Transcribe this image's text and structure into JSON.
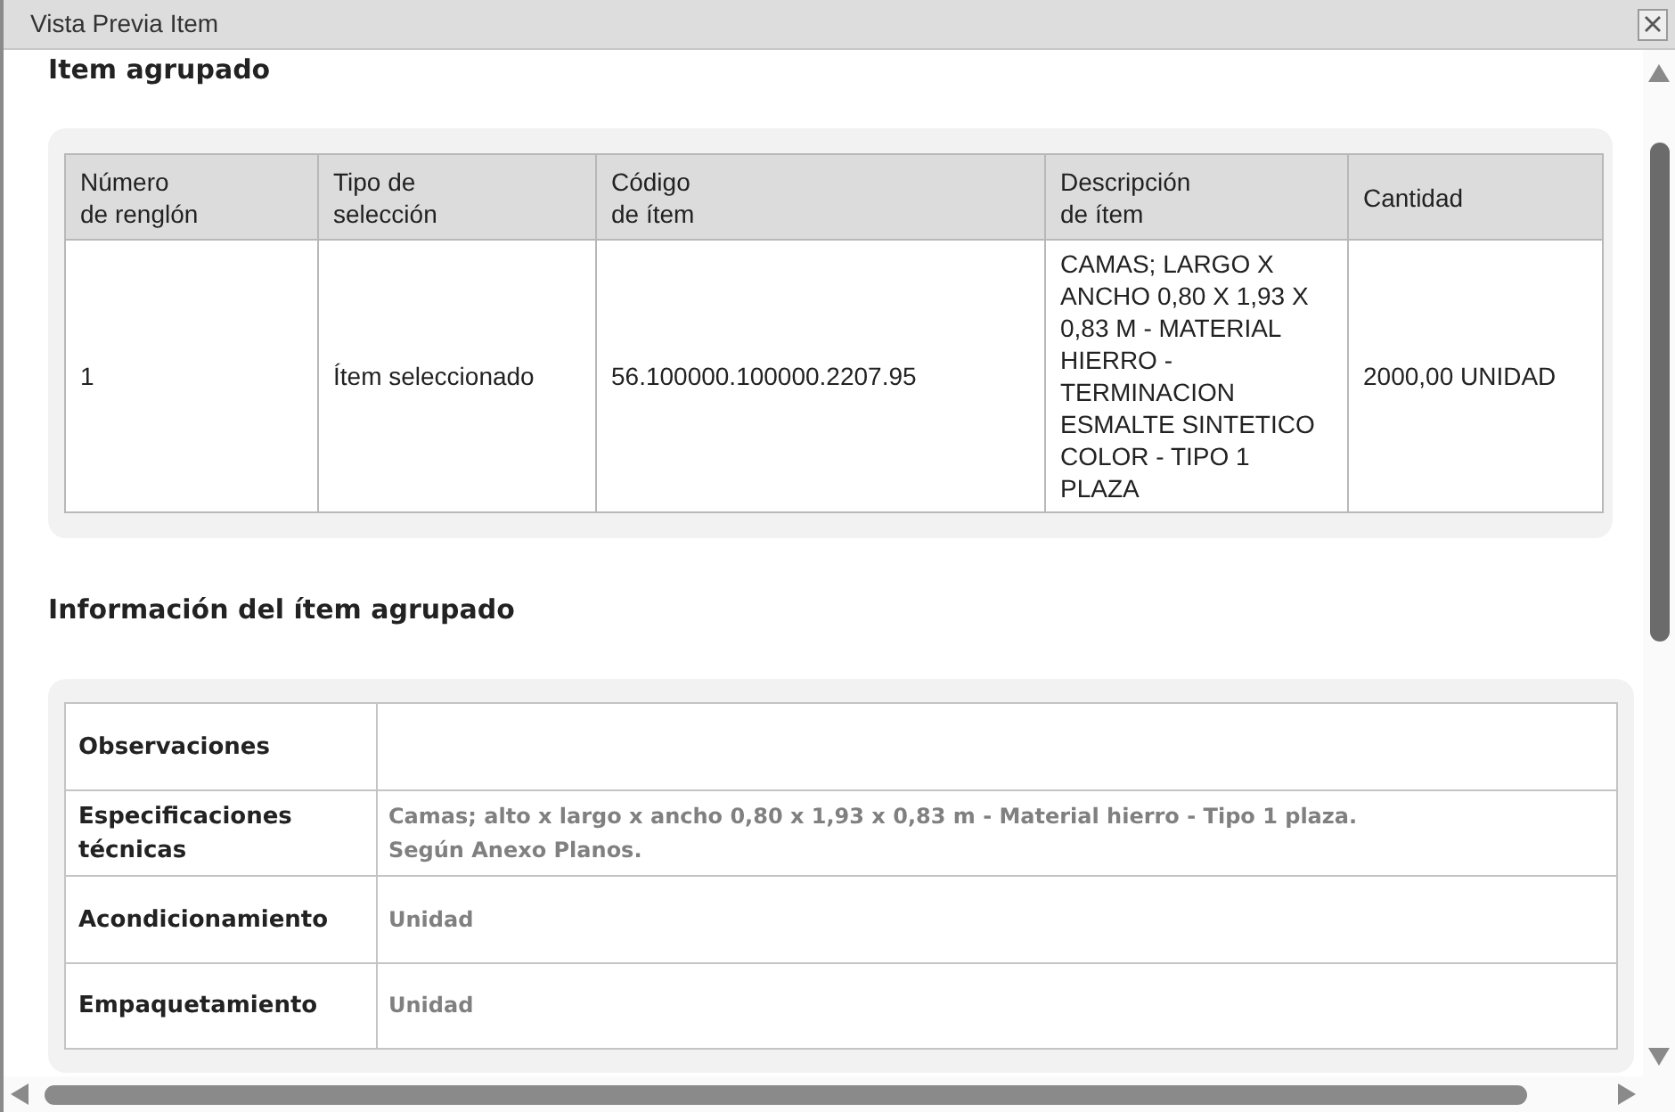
{
  "window": {
    "title": "Vista Previa Item"
  },
  "grouped_item": {
    "heading": "Item agrupado",
    "columns": [
      "Número\nde renglón",
      "Tipo de\nselección",
      "Código\nde ítem",
      "Descripción\nde ítem",
      "Cantidad"
    ],
    "rows": [
      [
        "1",
        "Ítem seleccionado",
        "56.100000.100000.2207.95",
        "CAMAS; LARGO X ANCHO 0,80 X 1,93 X 0,83 M - MATERIAL HIERRO - TERMINACION ESMALTE SINTETICO COLOR - TIPO 1 PLAZA",
        "2000,00 UNIDAD"
      ]
    ]
  },
  "grouped_item_info": {
    "heading": "Información del ítem agrupado",
    "rows": [
      {
        "label": "Observaciones"
      },
      {
        "label": "Especificaciones técnicas",
        "value": "Camas; alto x largo x ancho 0,80 x 1,93 x 0,83 m - Material hierro - Tipo 1 plaza.\nSegún Anexo Planos."
      },
      {
        "label": "Acondicionamiento",
        "value": "Unidad"
      },
      {
        "label": "Empaquetamiento",
        "value": "Unidad"
      }
    ]
  }
}
